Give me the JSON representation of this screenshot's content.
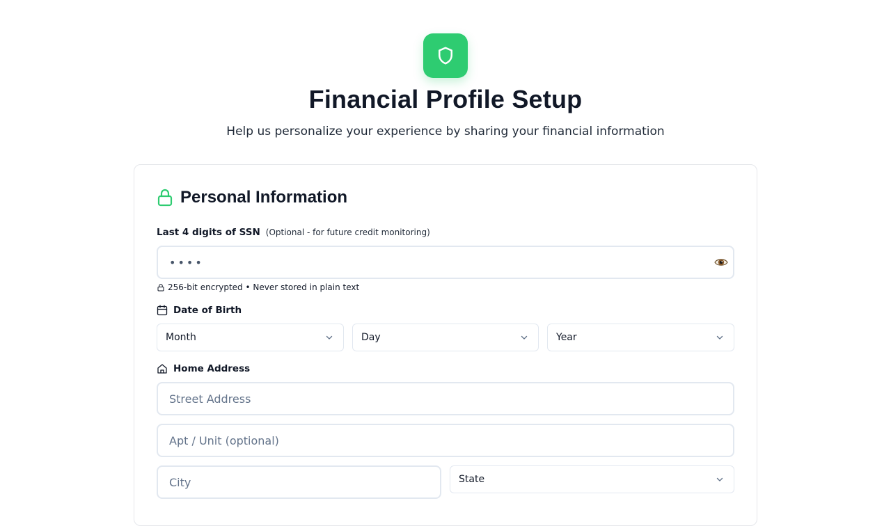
{
  "header": {
    "logo_icon": "shield-icon",
    "brand_color": "#2ecc71",
    "title": "Financial Profile Setup",
    "subtitle": "Help us personalize your experience by sharing your financial information"
  },
  "personal": {
    "section_icon": "lock-icon",
    "section_title": "Personal Information",
    "ssn": {
      "label": "Last 4 digits of SSN",
      "hint": "(Optional - for future credit monitoring)",
      "value": "••••",
      "toggle_icon": "eye-icon",
      "secure_note": "256-bit encrypted • Never stored in plain text"
    },
    "dob": {
      "icon": "calendar-icon",
      "label": "Date of Birth",
      "month": "Month",
      "day": "Day",
      "year": "Year"
    },
    "address": {
      "icon": "home-icon",
      "label": "Home Address",
      "street_placeholder": "Street Address",
      "apt_placeholder": "Apt / Unit (optional)",
      "city_placeholder": "City",
      "state": "State"
    }
  }
}
